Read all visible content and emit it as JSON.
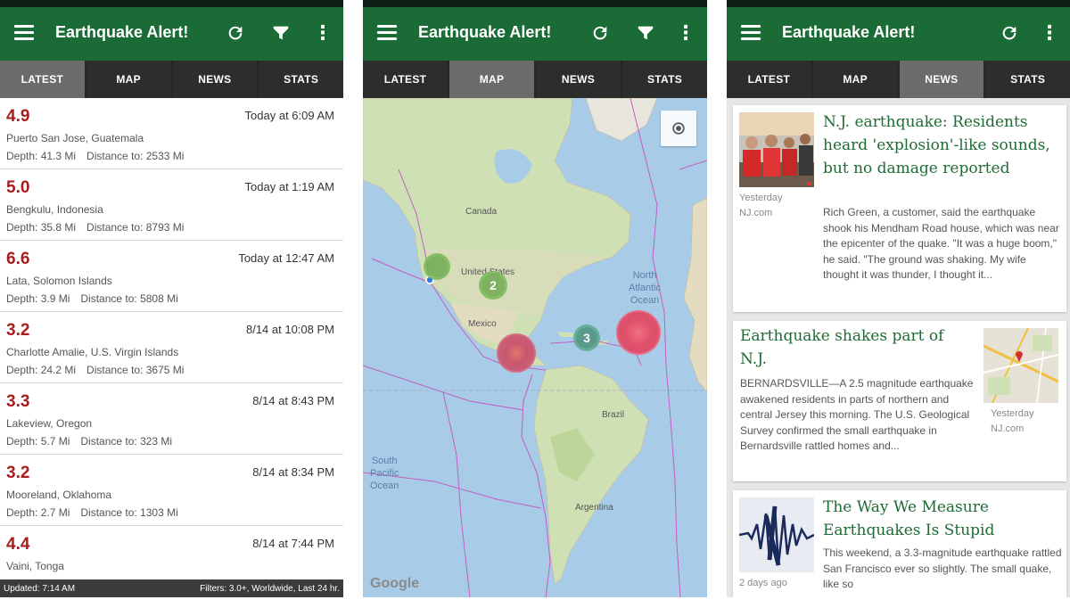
{
  "app": {
    "title": "Earthquake Alert!"
  },
  "tabs": [
    "LATEST",
    "MAP",
    "NEWS",
    "STATS"
  ],
  "quakes": [
    {
      "mag": "4.9",
      "time": "Today at 6:09 AM",
      "place": "Puerto San Jose, Guatemala",
      "depth": "Depth: 41.3 Mi",
      "distance": "Distance to: 2533 Mi"
    },
    {
      "mag": "5.0",
      "time": "Today at 1:19 AM",
      "place": "Bengkulu, Indonesia",
      "depth": "Depth: 35.8 Mi",
      "distance": "Distance to: 8793 Mi"
    },
    {
      "mag": "6.6",
      "time": "Today at 12:47 AM",
      "place": "Lata, Solomon Islands",
      "depth": "Depth: 3.9 Mi",
      "distance": "Distance to: 5808 Mi"
    },
    {
      "mag": "3.2",
      "time": "8/14 at 10:08 PM",
      "place": "Charlotte Amalie, U.S. Virgin Islands",
      "depth": "Depth: 24.2 Mi",
      "distance": "Distance to: 3675 Mi"
    },
    {
      "mag": "3.3",
      "time": "8/14 at 8:43 PM",
      "place": "Lakeview, Oregon",
      "depth": "Depth: 5.7 Mi",
      "distance": "Distance to: 323 Mi"
    },
    {
      "mag": "3.2",
      "time": "8/14 at 8:34 PM",
      "place": "Mooreland, Oklahoma",
      "depth": "Depth: 2.7 Mi",
      "distance": "Distance to: 1303 Mi"
    },
    {
      "mag": "4.4",
      "time": "8/14 at 7:44 PM",
      "place": "Vaini, Tonga",
      "depth": "",
      "distance": ""
    }
  ],
  "footer": {
    "updated": "Updated: 7:14 AM",
    "filters": "Filters: 3.0+, Worldwide, Last 24 hr."
  },
  "map": {
    "labels": {
      "canada": "Canada",
      "us": "United States",
      "mexico": "Mexico",
      "brazil": "Brazil",
      "argentina": "Argentina"
    },
    "north_atlantic": [
      "North",
      "Atlantic",
      "Ocean"
    ],
    "south_pacific": [
      "South",
      "Pacific",
      "Ocean"
    ],
    "clusters": [
      "2",
      "3"
    ],
    "brand": "Google"
  },
  "news": [
    {
      "headline": "N.J. earthquake: Residents heard 'explosion'-like sounds, but no damage reported",
      "body": "Rich Green, a customer, said the earthquake shook his Mendham Road house, which was near the epicenter of the quake. \"It was a huge boom,\" he said. \"The ground was shaking. My wife thought it was thunder, I thought it...",
      "when": "Yesterday",
      "source": "NJ.com"
    },
    {
      "headline": "Earthquake shakes part of N.J.",
      "body": "BERNARDSVILLE—A 2.5 magnitude earthquake awakened residents in parts of northern and central Jersey this morning. The U.S. Geological Survey confirmed the small earthquake in Bernardsville rattled homes and...",
      "when": "Yesterday",
      "source": "NJ.com"
    },
    {
      "headline": "The Way We Measure Earthquakes Is Stupid",
      "body": "This weekend, a 3.3-magnitude earthquake rattled San Francisco ever so slightly. The small quake, like so",
      "when": "2 days ago",
      "source": ""
    }
  ],
  "colors": {
    "appbar": "#1a6b35",
    "magnitude": "#a81d1d",
    "headline": "#1f6b35"
  },
  "icons": [
    "menu-icon",
    "refresh-icon",
    "filter-icon",
    "more-vert-icon",
    "my-location-icon"
  ]
}
